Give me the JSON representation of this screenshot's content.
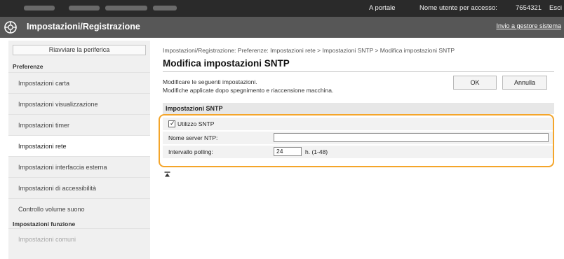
{
  "topbar": {
    "portal_label": "A portale",
    "user_label": "Nome utente per accesso:",
    "user_value": "7654321",
    "logout_label": "Esci"
  },
  "header": {
    "title": "Impostazioni/Registrazione",
    "logo_icon": "gear-icon",
    "system_link": "Invio a gestore sistema"
  },
  "sidebar": {
    "restart_label": "Riavviare la periferica",
    "section1": "Preferenze",
    "items": [
      {
        "label": "Impostazioni carta",
        "state": "normal"
      },
      {
        "label": "Impostazioni visualizzazione",
        "state": "normal"
      },
      {
        "label": "Impostazioni timer",
        "state": "normal"
      },
      {
        "label": "Impostazioni rete",
        "state": "active"
      },
      {
        "label": "Impostazioni interfaccia esterna",
        "state": "normal"
      },
      {
        "label": "Impostazioni di accessibilità",
        "state": "normal"
      },
      {
        "label": "Controllo volume suono",
        "state": "normal"
      }
    ],
    "section2": "Impostazioni funzione",
    "items2": [
      {
        "label": "Impostazioni comuni",
        "state": "disabled"
      }
    ]
  },
  "main": {
    "breadcrumb": "Impostazioni/Registrazione: Preferenze: Impostazioni rete > Impostazioni SNTP > Modifica impostazioni SNTP",
    "title": "Modifica impostazioni SNTP",
    "desc1": "Modificare le seguenti impostazioni.",
    "desc2": "Modifiche applicate dopo spegnimento e riaccensione macchina.",
    "ok_label": "OK",
    "cancel_label": "Annulla",
    "section_title": "Impostazioni SNTP",
    "use_sntp_label": "Utilizzo SNTP",
    "use_sntp_checked": true,
    "ntp_label": "Nome server NTP:",
    "ntp_value": "",
    "polling_label": "Intervallo polling:",
    "polling_value": "24",
    "polling_unit": "h. (1-48)",
    "top_icon": "to-top-icon",
    "highlight_color": "#f4a52a"
  }
}
